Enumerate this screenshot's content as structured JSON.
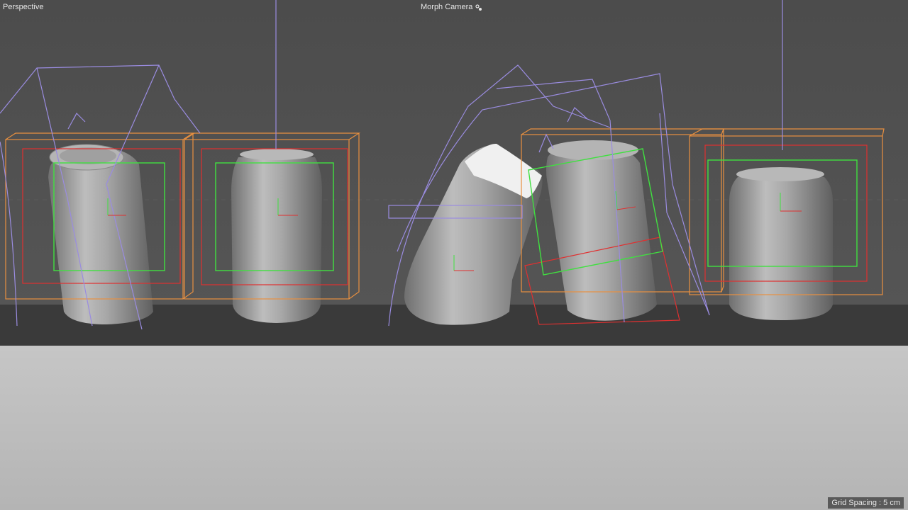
{
  "viewport": {
    "label": "Perspective",
    "camera_label": "Morph Camera",
    "camera_icon": "camera-gear-icon",
    "grid_spacing": "Grid Spacing : 5 cm"
  },
  "colors": {
    "background": "#4a4a4a",
    "floor": "#bdbdbd",
    "backdrop": "#3b3b3b",
    "can": "#9c9c9c",
    "bounds_orange": "#e89040",
    "bounds_red": "#e03030",
    "bounds_green": "#40e040",
    "deformer_violet": "#9a8ce0"
  }
}
